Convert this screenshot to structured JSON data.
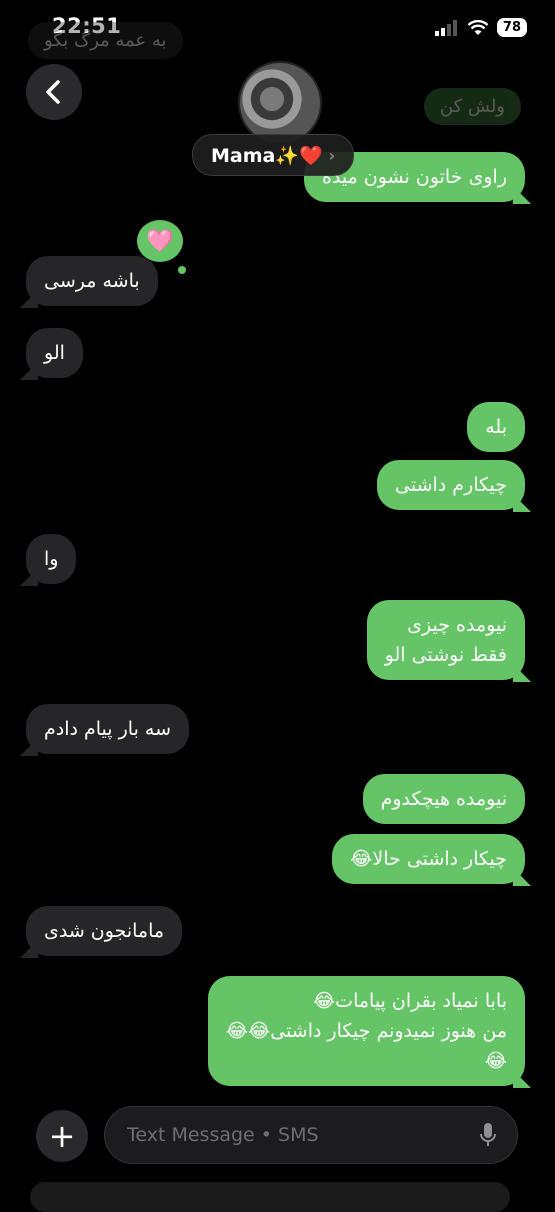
{
  "status": {
    "time": "22:51",
    "battery": "78"
  },
  "header": {
    "contact_name": "Mama✨❤️",
    "chevron": "›"
  },
  "ghost_top": {
    "left": "به عمه مرگ بگو",
    "right": "ولش کن"
  },
  "tapback": {
    "emoji": "🩷"
  },
  "messages": [
    {
      "dir": "out",
      "text": "راوی خاتون نشون میده"
    },
    {
      "dir": "in",
      "text": "باشه مرسی"
    },
    {
      "dir": "in",
      "text": "الو"
    },
    {
      "dir": "out",
      "text": "بله"
    },
    {
      "dir": "out",
      "text": "چیکارم داشتی"
    },
    {
      "dir": "in",
      "text": "وا"
    },
    {
      "dir": "out",
      "text": "نیومده چیزی\nفقط نوشتی الو"
    },
    {
      "dir": "in",
      "text": "سه بار پیام دادم"
    },
    {
      "dir": "out",
      "text": "نیومده هیچکدوم"
    },
    {
      "dir": "out",
      "text": "چیکار داشتی حالا😂"
    },
    {
      "dir": "in",
      "text": "مامانجون شدی"
    },
    {
      "dir": "out",
      "text": "بابا نمیاد بقران پیامات😂\nمن هنوز نمیدونم چیکار داشتی😂😂\n😂"
    }
  ],
  "composer": {
    "placeholder": "Text Message • SMS",
    "plus": "+"
  },
  "icons": {
    "back": "chevron-left-icon",
    "signal": "signal-icon",
    "wifi": "wifi-icon",
    "battery": "battery-icon",
    "mic": "mic-icon",
    "plus": "plus-icon"
  },
  "colors": {
    "incoming": "#262628",
    "outgoing": "#65c466",
    "background": "#000000"
  }
}
